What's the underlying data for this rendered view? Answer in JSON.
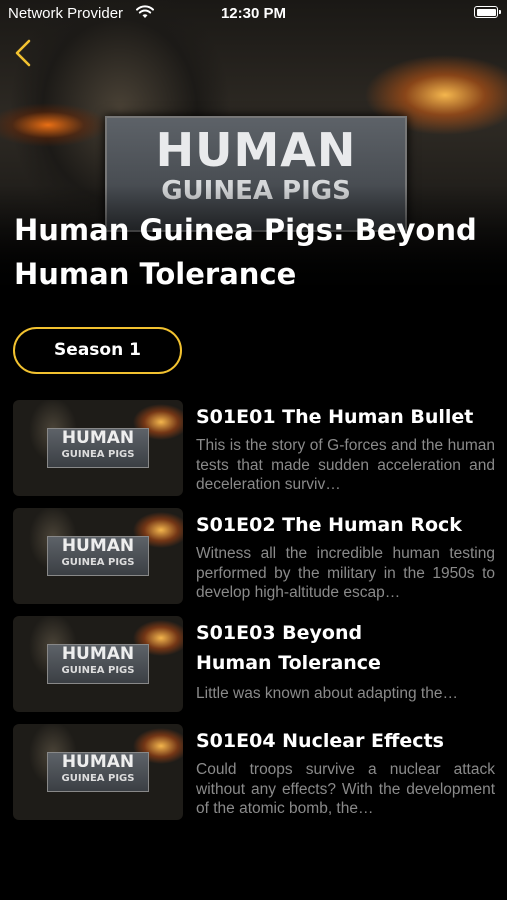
{
  "status_bar": {
    "carrier": "Network Provider",
    "time": "12:30 PM"
  },
  "hero": {
    "logo_line1": "HUMAN",
    "logo_line2": "GUINEA PIGS",
    "title": "Human Guinea Pigs: Beyond Human Tolerance"
  },
  "season": {
    "label": "Season 1"
  },
  "episodes": [
    {
      "title": "S01E01 The Human Bullet",
      "description": "This is the story of G-forces and the human tests that made sudden acceleration and deceleration surviv…"
    },
    {
      "title": "S01E02 The Human Rock",
      "description": "Witness all the incredible human testing performed by the military in the 1950s to develop high-altitude escap…"
    },
    {
      "title": "S01E03 Beyond Human Tolerance",
      "description": "Little was known about adapting the…"
    },
    {
      "title": "S01E04 Nuclear Effects",
      "description": "Could troops survive a nuclear attack without any effects? With the development of the atomic bomb, the…"
    }
  ],
  "thumb_logo": {
    "line1": "HUMAN",
    "line2": "GUINEA PIGS"
  },
  "colors": {
    "accent": "#f2c230",
    "background": "#000000",
    "description_text": "#8a8a8a"
  }
}
